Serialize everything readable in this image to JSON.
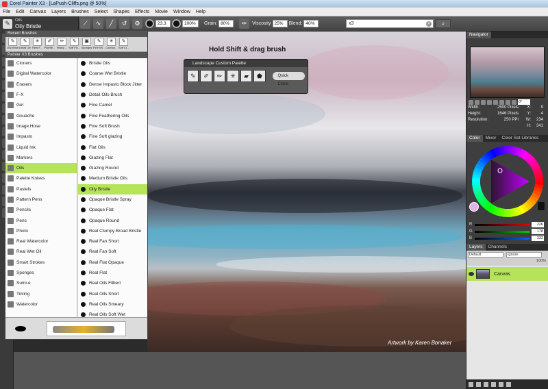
{
  "window": {
    "title": "Corel Painter X3 - [LaPush-Cliffs.png @ 50%]"
  },
  "menu": [
    "File",
    "Edit",
    "Canvas",
    "Layers",
    "Brushes",
    "Select",
    "Shapes",
    "Effects",
    "Movie",
    "Window",
    "Help"
  ],
  "propbar": {
    "brush_category": "Oils",
    "brush_variant": "Oily Bristle",
    "size": "23.3",
    "opacity": "100%",
    "grain_label": "Grain:",
    "grain": "80%",
    "viscosity_label": "Viscosity",
    "viscosity": "25%",
    "blend_label": "Blend:",
    "blend": "40%"
  },
  "search": {
    "value": "x3"
  },
  "recent_brushes": {
    "header": "Recent Brushes",
    "items": [
      "Oily Bristle",
      "Detail Oils",
      "Real F...",
      "Palette...",
      "Heavy ...",
      "Soft Flo...",
      "Sponges",
      "Fine Wi...",
      "Clumpy...",
      "Soft Cl..."
    ]
  },
  "brush_library": {
    "header": "Painter X3 Brushes",
    "categories": [
      "Cloners",
      "Digital Watercolor",
      "Erasers",
      "F-X",
      "Gel",
      "Gouache",
      "Image Hose",
      "Impasto",
      "Liquid Ink",
      "Markers",
      "Oils",
      "Palette Knives",
      "Pastels",
      "Pattern Pens",
      "Pencils",
      "Pens",
      "Photo",
      "Real Watercolor",
      "Real Wet Oil",
      "Smart Strokes",
      "Sponges",
      "Sumi-e",
      "Tinting",
      "Watercolor"
    ],
    "selected_category": "Oils",
    "variants": [
      "Bristle Oils",
      "Coarse Wet Bristle",
      "Dense Impasto Block Jitter",
      "Detail Oils Brush",
      "Fine Camel",
      "Fine Feathering Oils",
      "Fine Soft Brush",
      "Fine Soft glazing",
      "Flat Oils",
      "Glazing Flat",
      "Glazing Round",
      "Medium Bristle Oils",
      "Oily Bristle",
      "Opaque Bristle Spray",
      "Opaque Flat",
      "Opaque Round",
      "Real Clumpy Broad Bristle",
      "Real Fan Short",
      "Real Fan Soft",
      "Real Flat Opaque",
      "Real Flat",
      "Real Oils Filbert",
      "Real Oils Short",
      "Real Oils Smeary",
      "Real Oils Soft Wet"
    ],
    "selected_variant": "Oily Bristle"
  },
  "canvas": {
    "hint": "Hold Shift & drag brush",
    "credit": "Artwork by Karen Bonaker"
  },
  "custom_palette": {
    "title": "Landscape Custom Palette",
    "quick_clone": "Quick Clone"
  },
  "navigator": {
    "title": "Navigator",
    "zoom": "0°",
    "width_label": "Width:",
    "width": "2500 Pixels",
    "height_label": "Height:",
    "height": "1646 Pixels",
    "resolution_label": "Resolution:",
    "resolution": "250 PPI",
    "x_label": "X:",
    "x": "9",
    "y_label": "Y:",
    "y": "4",
    "w_label": "W:",
    "w": "234",
    "h_label": "H:",
    "h": "341"
  },
  "color_panel": {
    "tabs": [
      "Color",
      "Mixer",
      "Color Set Libraries"
    ],
    "r": 226,
    "g": 178,
    "b": 232,
    "current_color": "#e2b2e8"
  },
  "layers_panel": {
    "tabs": [
      "Layers",
      "Channels"
    ],
    "composite": "Default",
    "ignore": "Ignore",
    "opacity": "100%",
    "layer_name": "Canvas"
  }
}
